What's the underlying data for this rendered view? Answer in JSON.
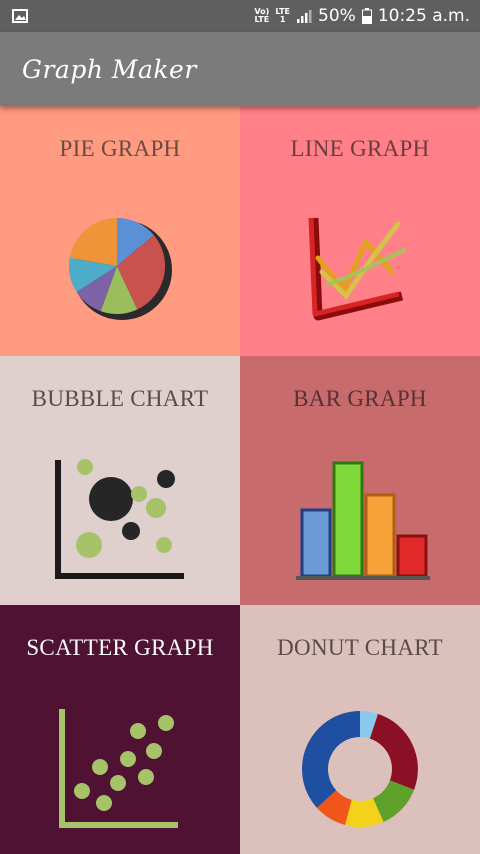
{
  "status_bar": {
    "net_top": "Vo)",
    "net_bottom": "LTE",
    "lte_top": "LTE",
    "lte_bottom": "1",
    "battery": "50%",
    "time": "10:25 a.m."
  },
  "app": {
    "title": "Graph Maker"
  },
  "tiles": [
    {
      "label": "PIE GRAPH",
      "bg": "#ff9b80",
      "text_color": "#6a4a3f",
      "icon": "pie-chart-icon"
    },
    {
      "label": "LINE GRAPH",
      "bg": "#ff8088",
      "text_color": "#6a3b3f",
      "icon": "line-chart-icon"
    },
    {
      "label": "BUBBLE CHART",
      "bg": "#dfd0ce",
      "text_color": "#5a4a48",
      "icon": "bubble-chart-icon"
    },
    {
      "label": "BAR GRAPH",
      "bg": "#c76b6c",
      "text_color": "#5a3033",
      "icon": "bar-chart-icon"
    },
    {
      "label": "SCATTER GRAPH",
      "bg": "#4f1233",
      "text_color": "#ffffff",
      "icon": "scatter-chart-icon"
    },
    {
      "label": "DONUT CHART",
      "bg": "#dcc0bb",
      "text_color": "#5a4a48",
      "icon": "donut-chart-icon"
    }
  ]
}
